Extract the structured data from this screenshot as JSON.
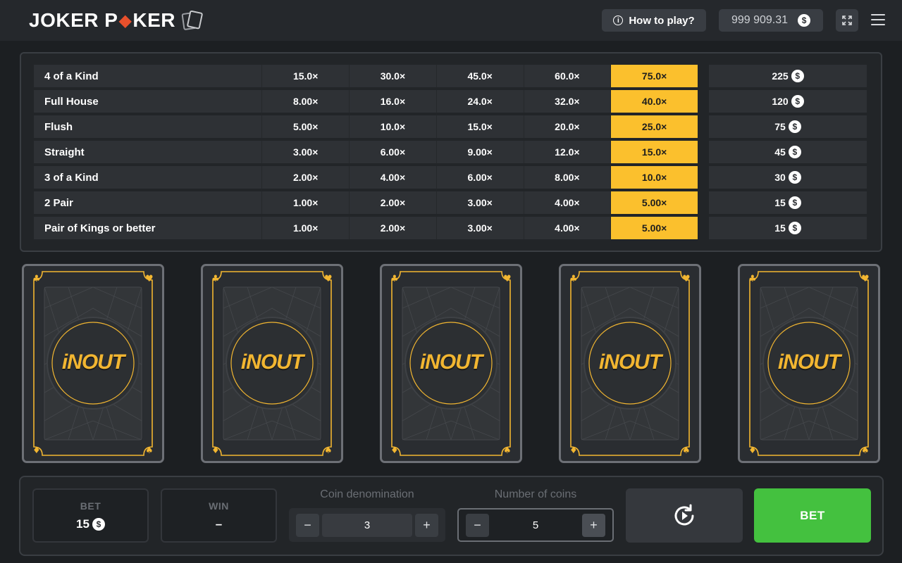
{
  "app": {
    "logo_part1": "JOKER P",
    "logo_diamond": "◆",
    "logo_part2": "KER"
  },
  "header": {
    "how_to_play": "How to play?",
    "balance": "999 909.31",
    "currency_symbol": "$"
  },
  "paytable": {
    "rows": [
      {
        "name": "4 of a Kind",
        "multipliers": [
          "15.0×",
          "30.0×",
          "45.0×",
          "60.0×",
          "75.0×"
        ],
        "win": "225"
      },
      {
        "name": "Full House",
        "multipliers": [
          "8.00×",
          "16.0×",
          "24.0×",
          "32.0×",
          "40.0×"
        ],
        "win": "120"
      },
      {
        "name": "Flush",
        "multipliers": [
          "5.00×",
          "10.0×",
          "15.0×",
          "20.0×",
          "25.0×"
        ],
        "win": "75"
      },
      {
        "name": "Straight",
        "multipliers": [
          "3.00×",
          "6.00×",
          "9.00×",
          "12.0×",
          "15.0×"
        ],
        "win": "45"
      },
      {
        "name": "3 of a Kind",
        "multipliers": [
          "2.00×",
          "4.00×",
          "6.00×",
          "8.00×",
          "10.0×"
        ],
        "win": "30"
      },
      {
        "name": "2 Pair",
        "multipliers": [
          "1.00×",
          "2.00×",
          "3.00×",
          "4.00×",
          "5.00×"
        ],
        "win": "15"
      },
      {
        "name": "Pair of Kings or better",
        "multipliers": [
          "1.00×",
          "2.00×",
          "3.00×",
          "4.00×",
          "5.00×"
        ],
        "win": "15"
      }
    ],
    "highlight_column": 4,
    "highlight_color": "#fbc02d"
  },
  "cards": {
    "back_logo": "iNOUT",
    "count": 5,
    "accent_color": "#f2b631"
  },
  "controls": {
    "bet_label": "BET",
    "bet_value": "15",
    "win_label": "WIN",
    "win_value": "–",
    "coin_denom_label": "Coin denomination",
    "coin_denom_value": "3",
    "num_coins_label": "Number of coins",
    "num_coins_value": "5",
    "minus": "−",
    "plus": "+",
    "bet_button": "BET",
    "bet_button_color": "#44c13f"
  }
}
